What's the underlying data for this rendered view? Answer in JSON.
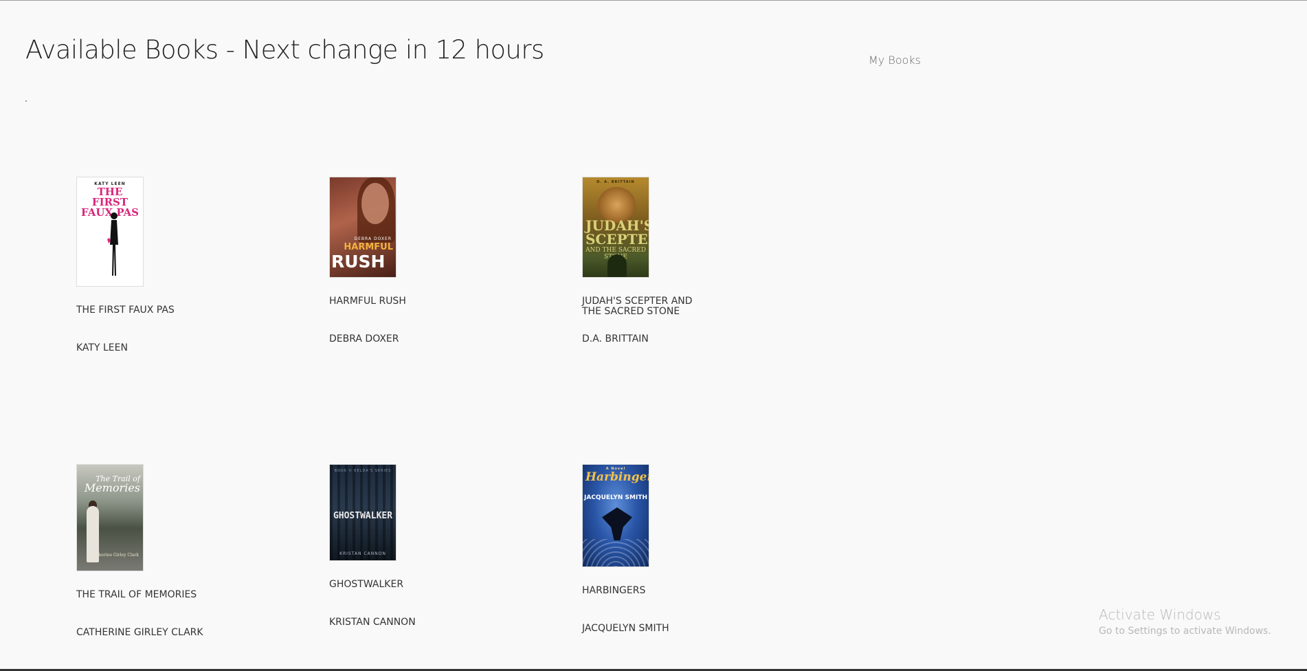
{
  "header": {
    "title": "Available Books - Next change in 12 hours"
  },
  "nav": {
    "my_books": "My Books"
  },
  "books": [
    {
      "title": "THE FIRST FAUX PAS",
      "author": "KATY LEEN",
      "cover": {
        "top": "KATY LEEN",
        "main": "THE FIRST FAUX PAS"
      }
    },
    {
      "title": "HARMFUL RUSH",
      "author": "DEBRA DOXER",
      "cover": {
        "sub": "DEBRA DOXER",
        "main": "HARMFUL",
        "main2": "RUSH"
      }
    },
    {
      "title": "JUDAH'S SCEPTER AND THE SACRED STONE",
      "author": "D.A. BRITTAIN",
      "cover": {
        "top": "D. A. BRITTAIN",
        "main": "JUDAH'S SCEPTER",
        "sub": "AND THE SACRED STONE"
      }
    },
    {
      "title": "THE TRAIL OF MEMORIES",
      "author": "CATHERINE GIRLEY CLARK",
      "cover": {
        "main": "The Trail of",
        "main_big": "Memories",
        "sub": "Catherine Girley Clark"
      }
    },
    {
      "title": "GHOSTWALKER",
      "author": "KRISTAN CANNON",
      "cover": {
        "top": "BOOK II KELDA'S SERIES",
        "main": "GHOSTWALKER",
        "sub": "KRISTAN CANNON"
      }
    },
    {
      "title": "HARBINGERS",
      "author": "JACQUELYN SMITH",
      "cover": {
        "top": "A Novel",
        "main": "Harbingers",
        "sub": "JACQUELYN SMITH"
      }
    }
  ],
  "watermark": {
    "title": "Activate Windows",
    "subtitle": "Go to Settings to activate Windows."
  }
}
